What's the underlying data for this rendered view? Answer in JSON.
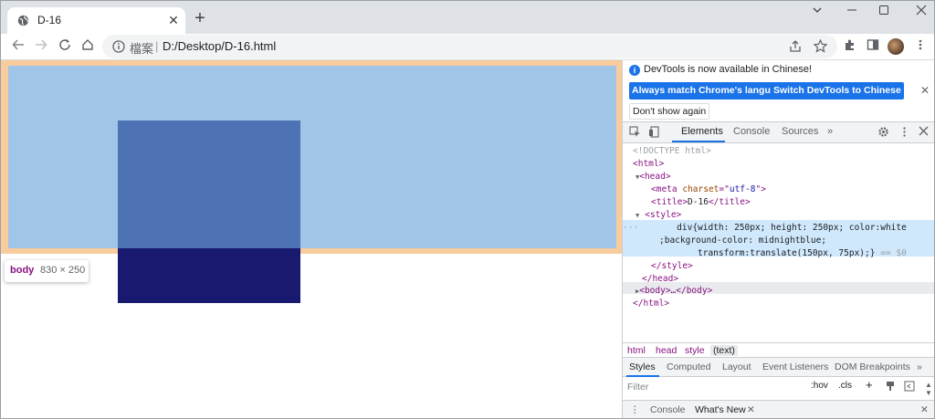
{
  "tab": {
    "title": "D-16"
  },
  "omnibox": {
    "scheme_label": "檔案",
    "separator": "|",
    "url": "D:/Desktop/D-16.html"
  },
  "tooltip": {
    "tag": "body",
    "size": "830 × 250"
  },
  "colors": {
    "margin": "#f9cc9d",
    "content": "#a0c5e8",
    "div_bg": "#191970",
    "accent": "#1a73e8"
  },
  "devtools": {
    "banner": {
      "message": "DevTools is now available in Chinese!",
      "btn_match": "Always match Chrome's language",
      "btn_switch": "Switch DevTools to Chinese",
      "btn_dont": "Don't show again"
    },
    "tabs": [
      "Elements",
      "Console",
      "Sources"
    ],
    "more": "»",
    "dom": {
      "doctype": "<!DOCTYPE html>",
      "html_open": "<html>",
      "head_open": "<head>",
      "meta_tag": "meta",
      "meta_attr": "charset",
      "meta_val": "utf-8",
      "title_line": "D-16",
      "style_open": "<style>",
      "css1": "div{width: 250px; height: 250px; color:white",
      "css2": ";background-color: midnightblue;",
      "css3": "transform:translate(150px, 75px);}",
      "eq": "== $0",
      "style_close": "</style>",
      "head_close": "</head>",
      "body_line": "<body>…</body>",
      "html_close": "</html>"
    },
    "breadcrumbs": [
      "html",
      "head",
      "style",
      "(text)"
    ],
    "styles_tabs": [
      "Styles",
      "Computed",
      "Layout",
      "Event Listeners",
      "DOM Breakpoints"
    ],
    "filter_placeholder": "Filter",
    "hov": ":hov",
    "cls": ".cls",
    "drawer_tabs": [
      "Console",
      "What's New"
    ]
  }
}
